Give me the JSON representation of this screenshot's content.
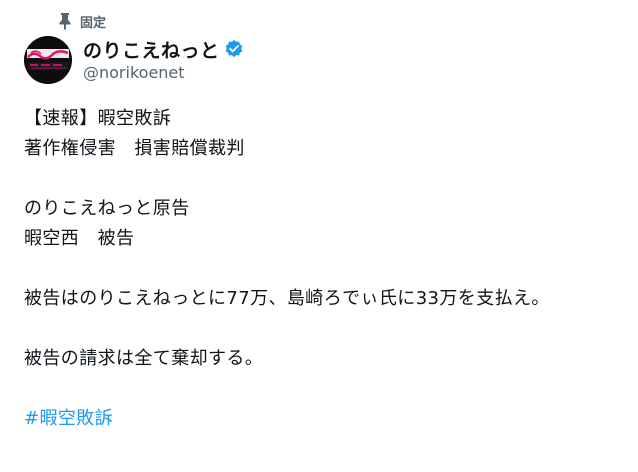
{
  "pinned": {
    "label": "固定",
    "icon": "pin-icon"
  },
  "author": {
    "display_name": "のりこえねっと",
    "handle": "@norikoenet",
    "verified": true,
    "verified_color": "#1d9bf0",
    "avatar_logo_text": "のりこえねっと"
  },
  "tweet": {
    "lines": [
      "【速報】暇空敗訴",
      "著作権侵害　損害賠償裁判",
      "",
      "のりこえねっと原告",
      "暇空西　被告",
      "",
      "被告はのりこえねっとに77万、島崎ろでぃ氏に33万を支払え。",
      "",
      "被告の請求は全て棄却する。",
      ""
    ],
    "hashtag": "#暇空敗訴",
    "hashtag_color": "#1d9bf0"
  }
}
